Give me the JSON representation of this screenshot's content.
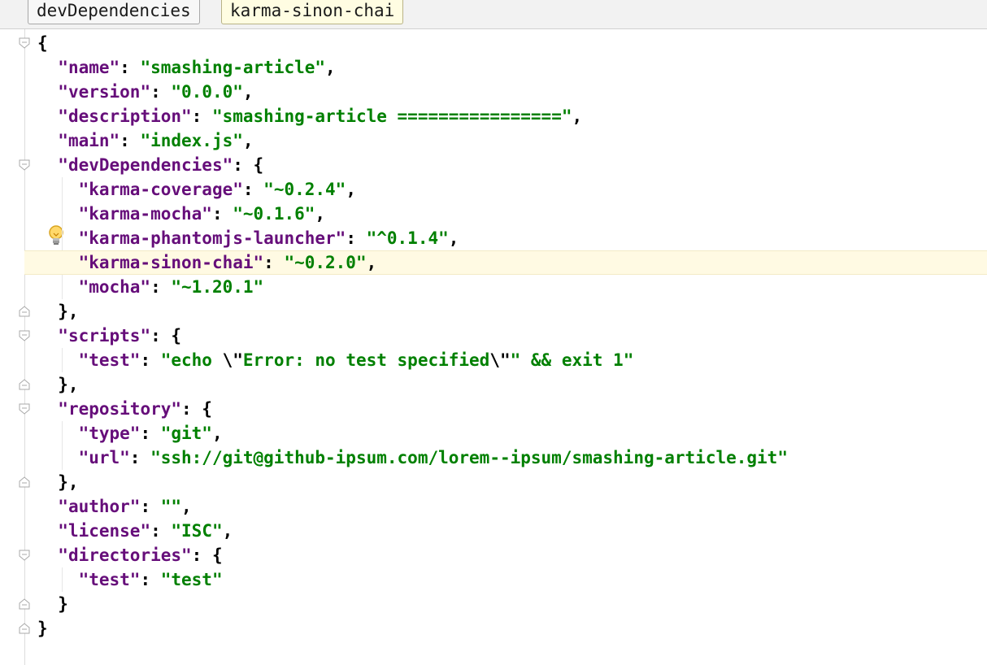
{
  "breadcrumb": {
    "items": [
      "devDependencies",
      "karma-sinon-chai"
    ]
  },
  "colors": {
    "key": "#660e7a",
    "string": "#008000",
    "current_line": "#fffae3"
  },
  "icons": {
    "intention": "lightbulb-icon",
    "fold": "fold-marker-icon"
  },
  "code": {
    "lines": [
      [
        [
          "p",
          "{"
        ]
      ],
      [
        [
          "p",
          "  "
        ],
        [
          "k",
          "\"name\""
        ],
        [
          "p",
          ": "
        ],
        [
          "s",
          "\"smashing-article\""
        ],
        [
          "p",
          ","
        ]
      ],
      [
        [
          "p",
          "  "
        ],
        [
          "k",
          "\"version\""
        ],
        [
          "p",
          ": "
        ],
        [
          "s",
          "\"0.0.0\""
        ],
        [
          "p",
          ","
        ]
      ],
      [
        [
          "p",
          "  "
        ],
        [
          "k",
          "\"description\""
        ],
        [
          "p",
          ": "
        ],
        [
          "s",
          "\"smashing-article ================\""
        ],
        [
          "p",
          ","
        ]
      ],
      [
        [
          "p",
          "  "
        ],
        [
          "k",
          "\"main\""
        ],
        [
          "p",
          ": "
        ],
        [
          "s",
          "\"index.js\""
        ],
        [
          "p",
          ","
        ]
      ],
      [
        [
          "p",
          "  "
        ],
        [
          "k",
          "\"devDependencies\""
        ],
        [
          "p",
          ": {"
        ]
      ],
      [
        [
          "p",
          "    "
        ],
        [
          "k",
          "\"karma-coverage\""
        ],
        [
          "p",
          ": "
        ],
        [
          "s",
          "\"~0.2.4\""
        ],
        [
          "p",
          ","
        ]
      ],
      [
        [
          "p",
          "    "
        ],
        [
          "k",
          "\"karma-mocha\""
        ],
        [
          "p",
          ": "
        ],
        [
          "s",
          "\"~0.1.6\""
        ],
        [
          "p",
          ","
        ]
      ],
      [
        [
          "p",
          "    "
        ],
        [
          "k",
          "\"karma-phantomjs-launcher\""
        ],
        [
          "p",
          ": "
        ],
        [
          "s",
          "\"^0.1.4\""
        ],
        [
          "p",
          ","
        ]
      ],
      [
        [
          "p",
          "    "
        ],
        [
          "k",
          "\"karma-sinon-chai\""
        ],
        [
          "p",
          ": "
        ],
        [
          "s",
          "\"~0.2.0\""
        ],
        [
          "p",
          ","
        ]
      ],
      [
        [
          "p",
          "    "
        ],
        [
          "k",
          "\"mocha\""
        ],
        [
          "p",
          ": "
        ],
        [
          "s",
          "\"~1.20.1\""
        ]
      ],
      [
        [
          "p",
          "  },"
        ]
      ],
      [
        [
          "p",
          "  "
        ],
        [
          "k",
          "\"scripts\""
        ],
        [
          "p",
          ": {"
        ]
      ],
      [
        [
          "p",
          "    "
        ],
        [
          "k",
          "\"test\""
        ],
        [
          "p",
          ": "
        ],
        [
          "s",
          "\"echo "
        ],
        [
          "p",
          "\\\""
        ],
        [
          "s",
          "Error: no test specified"
        ],
        [
          "p",
          "\\\""
        ],
        [
          "s",
          "\" && exit 1\""
        ]
      ],
      [
        [
          "p",
          "  },"
        ]
      ],
      [
        [
          "p",
          "  "
        ],
        [
          "k",
          "\"repository\""
        ],
        [
          "p",
          ": {"
        ]
      ],
      [
        [
          "p",
          "    "
        ],
        [
          "k",
          "\"type\""
        ],
        [
          "p",
          ": "
        ],
        [
          "s",
          "\"git\""
        ],
        [
          "p",
          ","
        ]
      ],
      [
        [
          "p",
          "    "
        ],
        [
          "k",
          "\"url\""
        ],
        [
          "p",
          ": "
        ],
        [
          "s",
          "\"ssh://git@github-ipsum.com/lorem--ipsum/smashing-article.git\""
        ]
      ],
      [
        [
          "p",
          "  },"
        ]
      ],
      [
        [
          "p",
          "  "
        ],
        [
          "k",
          "\"author\""
        ],
        [
          "p",
          ": "
        ],
        [
          "s",
          "\"\""
        ],
        [
          "p",
          ","
        ]
      ],
      [
        [
          "p",
          "  "
        ],
        [
          "k",
          "\"license\""
        ],
        [
          "p",
          ": "
        ],
        [
          "s",
          "\"ISC\""
        ],
        [
          "p",
          ","
        ]
      ],
      [
        [
          "p",
          "  "
        ],
        [
          "k",
          "\"directories\""
        ],
        [
          "p",
          ": {"
        ]
      ],
      [
        [
          "p",
          "    "
        ],
        [
          "k",
          "\"test\""
        ],
        [
          "p",
          ": "
        ],
        [
          "s",
          "\"test\""
        ]
      ],
      [
        [
          "p",
          "  }"
        ]
      ],
      [
        [
          "p",
          "}"
        ]
      ]
    ],
    "current_line_index": 9,
    "bulb_line_index": 8,
    "fold_markers": [
      {
        "line": 0,
        "kind": "open"
      },
      {
        "line": 5,
        "kind": "open"
      },
      {
        "line": 11,
        "kind": "close"
      },
      {
        "line": 12,
        "kind": "open"
      },
      {
        "line": 14,
        "kind": "close"
      },
      {
        "line": 15,
        "kind": "open"
      },
      {
        "line": 18,
        "kind": "close"
      },
      {
        "line": 21,
        "kind": "open"
      },
      {
        "line": 23,
        "kind": "close"
      },
      {
        "line": 24,
        "kind": "close"
      }
    ]
  }
}
